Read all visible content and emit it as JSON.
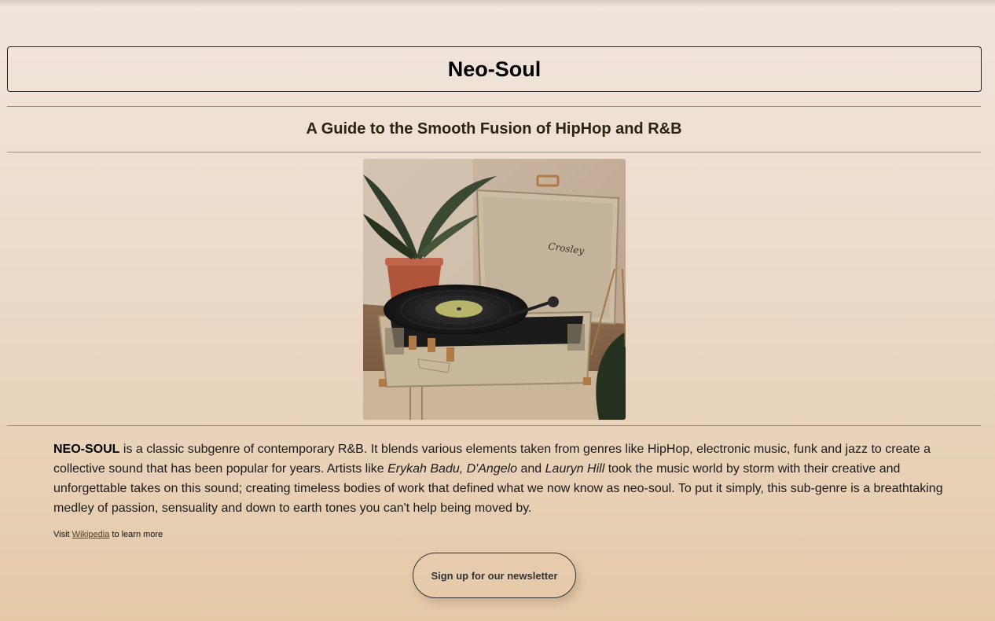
{
  "header": {
    "title": "Neo-Soul",
    "subtitle": "A Guide to the Smooth Fusion of HipHop and R&B"
  },
  "hero_image": {
    "description_icon": "record-player-image",
    "brand_text": "Crosley"
  },
  "article": {
    "lead_bold": "NEO-SOUL",
    "part1": " is a classic subgenre of contemporary R&B. It blends various elements taken from genres like HipHop, electronic music, funk and jazz to create a collective sound that has been popular for years. Artists like ",
    "artists_italic_1": "Erykah Badu, D'Angelo",
    "part2": " and ",
    "artists_italic_2": "Lauryn Hill",
    "part3": " took the music world by storm with their creative and unforgettable takes on this sound; creating timeless bodies of work that defined what we now know as neo-soul. To put it simply, this sub-genre is a breathtaking medley of passion, sensuality and down to earth tones you can't help being moved by."
  },
  "footer_note": {
    "prefix": "Visit ",
    "link_text": "Wikipedia",
    "suffix": " to learn more"
  },
  "cta": {
    "newsletter_label": "Sign up for our newsletter"
  },
  "colors": {
    "background_top": "#f1e5dd",
    "background_bottom": "#e5c9a7",
    "rule": "#8a8f9c",
    "subtitle": "#2a2410"
  }
}
